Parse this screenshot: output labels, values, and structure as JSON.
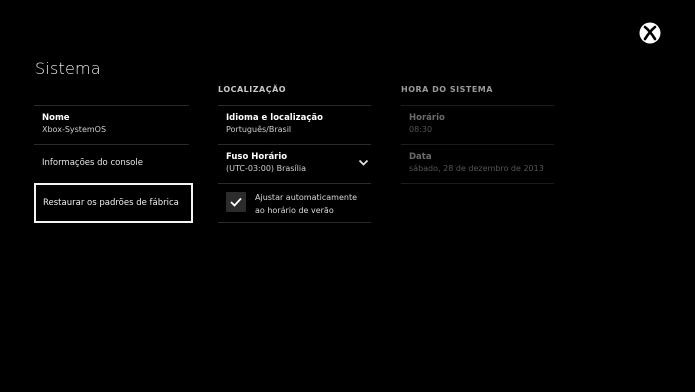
{
  "page": {
    "title": "Sistema"
  },
  "left_menu": {
    "items": [
      {
        "label": "Nome",
        "value": "Xbox-SystemOS"
      },
      {
        "label": "Informações do console"
      },
      {
        "label": "Restaurar os padrões de fábrica"
      }
    ]
  },
  "localization": {
    "header": "LOCALIZAÇÃO",
    "language": {
      "label": "Idioma e localização",
      "value": "Português/Brasil"
    },
    "timezone": {
      "label": "Fuso Horário",
      "value": "(UTC-03:00) Brasília"
    },
    "dst": {
      "label_line1": "Ajustar automaticamente",
      "label_line2": "ao horário de verão",
      "checked": true
    }
  },
  "system_time": {
    "header": "HORA DO SISTEMA",
    "time": {
      "label": "Horário",
      "value": "08:30"
    },
    "date": {
      "label": "Data",
      "value": "sábado, 28 de dezembro de 2013"
    }
  },
  "colors": {
    "background": "#000000",
    "focus_border": "#f4f4f4"
  },
  "icons": [
    "xbox-logo-icon",
    "chevron-down-icon",
    "check-icon"
  ]
}
